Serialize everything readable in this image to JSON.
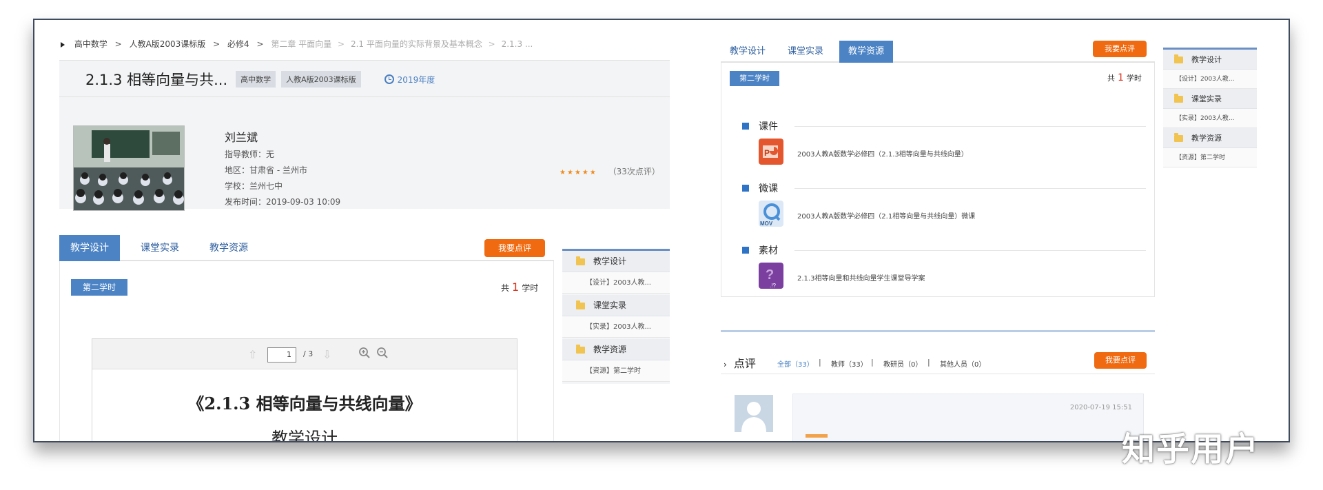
{
  "breadcrumb": {
    "items": [
      "高中数学",
      "人教A版2003课标版",
      "必修4"
    ],
    "dim_items": [
      "第二章 平面向量",
      "2.1 平面向量的实际背景及基本概念",
      "2.1.3 ..."
    ],
    "separator": ">"
  },
  "resource": {
    "title": "2.1.3 相等向量与共...",
    "tags": [
      "高中数学",
      "人教A版2003课标版"
    ],
    "year": "2019年度",
    "author": "刘兰斌",
    "advisor": "指导教师：无",
    "region": "地区：甘肃省 - 兰州市",
    "school": "学校：兰州七中",
    "published": "发布时间：2019-09-03 10:09",
    "stars_icon": "★★★★★",
    "review_count": "（33次点评）",
    "rating_value": 4.5
  },
  "left_tabs": {
    "items": [
      "教学设计",
      "课堂实录",
      "教学资源"
    ],
    "active_index": 0
  },
  "review_button": "我要点评",
  "period": {
    "tag": "第二学时",
    "prefix": "共",
    "count": "1",
    "suffix": "学时"
  },
  "viewer": {
    "page": "1",
    "total": "/ 3",
    "doc_title": "《2.1.3 相等向量与共线向量》",
    "doc_subtitle": "教学设计"
  },
  "sidebar": {
    "groups": [
      {
        "label": "教学设计",
        "sub": "【设计】2003人教..."
      },
      {
        "label": "课堂实录",
        "sub": "【实录】2003人教..."
      },
      {
        "label": "教学资源",
        "sub": "【资源】第二学时"
      }
    ]
  },
  "right_tabs": {
    "items": [
      "教学设计",
      "课堂实录",
      "教学资源"
    ],
    "active_index": 2
  },
  "resources": {
    "sections": [
      {
        "label": "课件",
        "file": "2003人教A版数学必修四（2.1.3相等向量与共线向量）",
        "icon": "powerpoint-icon",
        "color": "#e4572e"
      },
      {
        "label": "微课",
        "file": "2003人教A版数学必修四（2.1相等向量与共线向量）微课",
        "icon": "quicktime-movie-icon",
        "color": "#4a90d9"
      },
      {
        "label": "素材",
        "file": "2.1.3相等向量和共线向量学生课堂导学案",
        "icon": "unknown-file-icon",
        "color": "#7b3fa0"
      }
    ]
  },
  "reviews": {
    "title": "点评",
    "filters": [
      "全部（33）",
      "教师（33）",
      "教研员（0）",
      "其他人员（0）"
    ],
    "filter_sep": "|",
    "comment_time": "2020-07-19 15:51"
  },
  "watermark": "知乎用户"
}
